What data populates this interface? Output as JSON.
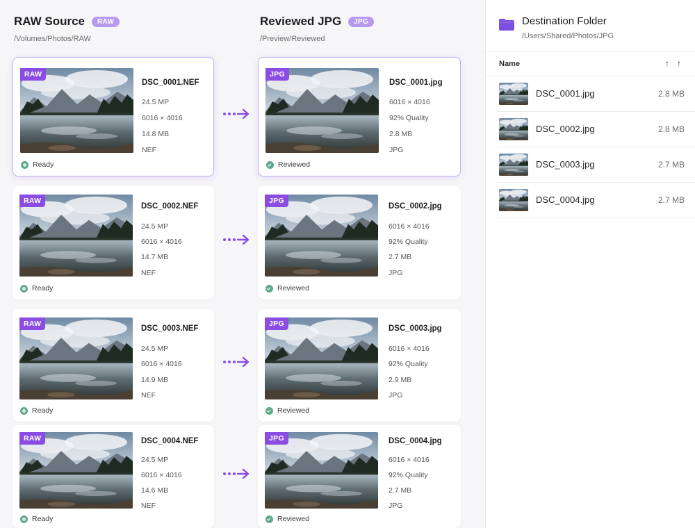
{
  "raw_column": {
    "title": "RAW Source",
    "badge": "RAW",
    "path": "/Volumes/Photos/RAW"
  },
  "jpg_column": {
    "title": "Reviewed JPG",
    "badge": "JPG",
    "path": "/Preview/Reviewed"
  },
  "raw_cards": [
    {
      "tag": "RAW",
      "filename": "DSC_0001.NEF",
      "megapixels": "24.5 MP",
      "dimensions": "6016 × 4016",
      "size": "14.8 MB",
      "format": "NEF",
      "status": "Ready"
    },
    {
      "tag": "RAW",
      "filename": "DSC_0002.NEF",
      "megapixels": "24.5 MP",
      "dimensions": "6016 × 4016",
      "size": "14.7 MB",
      "format": "NEF",
      "status": "Ready"
    },
    {
      "tag": "RAW",
      "filename": "DSC_0003.NEF",
      "megapixels": "24.5 MP",
      "dimensions": "6016 × 4016",
      "size": "14.9 MB",
      "format": "NEF",
      "status": "Ready"
    },
    {
      "tag": "RAW",
      "filename": "DSC_0004.NEF",
      "megapixels": "24.5 MP",
      "dimensions": "6016 × 4016",
      "size": "14.6 MB",
      "format": "NEF",
      "status": "Ready"
    }
  ],
  "jpg_cards": [
    {
      "tag": "JPG",
      "filename": "DSC_0001.jpg",
      "dimensions": "6016 × 4016",
      "quality": "92% Quality",
      "size": "2.8 MB",
      "format": "JPG",
      "status": "Reviewed"
    },
    {
      "tag": "JPG",
      "filename": "DSC_0002.jpg",
      "dimensions": "6016 × 4016",
      "quality": "92% Quality",
      "size": "2.7 MB",
      "format": "JPG",
      "status": "Reviewed"
    },
    {
      "tag": "JPG",
      "filename": "DSC_0003.jpg",
      "dimensions": "6016 × 4016",
      "quality": "92% Quality",
      "size": "2.9 MB",
      "format": "JPG",
      "status": "Reviewed"
    },
    {
      "tag": "JPG",
      "filename": "DSC_0004.jpg",
      "dimensions": "6016 × 4016",
      "quality": "92% Quality",
      "size": "2.7 MB",
      "format": "JPG",
      "status": "Reviewed"
    }
  ],
  "destination": {
    "title": "Destination Folder",
    "path": "/Users/Shared/Photos/JPG",
    "column_name": "Name",
    "files": [
      {
        "name": "DSC_0001.jpg",
        "size": "2.8 MB"
      },
      {
        "name": "DSC_0002.jpg",
        "size": "2.8 MB"
      },
      {
        "name": "DSC_0003.jpg",
        "size": "2.7 MB"
      },
      {
        "name": "DSC_0004.jpg",
        "size": "2.7 MB"
      }
    ]
  },
  "colors": {
    "accent": "#8a4ce2",
    "badge": "#b69af0",
    "status_green": "#5fa98a",
    "folder": "#7b4fe0"
  },
  "icons": {
    "arrow": "dotted-arrow-icon",
    "folder": "folder-icon",
    "sort": "sort-arrow-icon",
    "status_ready": "status-dot-icon",
    "status_reviewed": "check-circle-icon"
  }
}
